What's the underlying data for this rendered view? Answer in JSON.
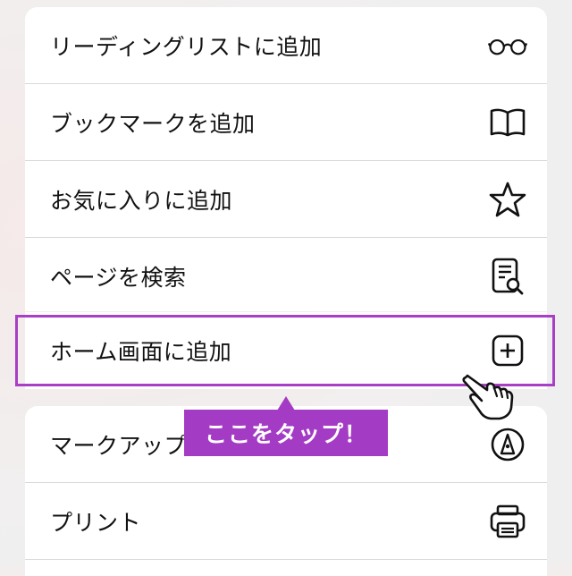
{
  "menu": {
    "items": [
      {
        "label": "リーディングリストに追加",
        "icon": "glasses-icon"
      },
      {
        "label": "ブックマークを追加",
        "icon": "book-icon"
      },
      {
        "label": "お気に入りに追加",
        "icon": "star-icon"
      },
      {
        "label": "ページを検索",
        "icon": "doc-search-icon"
      },
      {
        "label": "ホーム画面に追加",
        "icon": "plus-square-icon"
      },
      {
        "label": "マークアップ",
        "icon": "markup-pen-icon"
      },
      {
        "label": "プリント",
        "icon": "printer-icon"
      }
    ]
  },
  "callout": {
    "text": "ここをタップ！",
    "color": "#a43bc4"
  },
  "colors": {
    "highlight": "#a93fc6",
    "background": "#f2eeee"
  }
}
